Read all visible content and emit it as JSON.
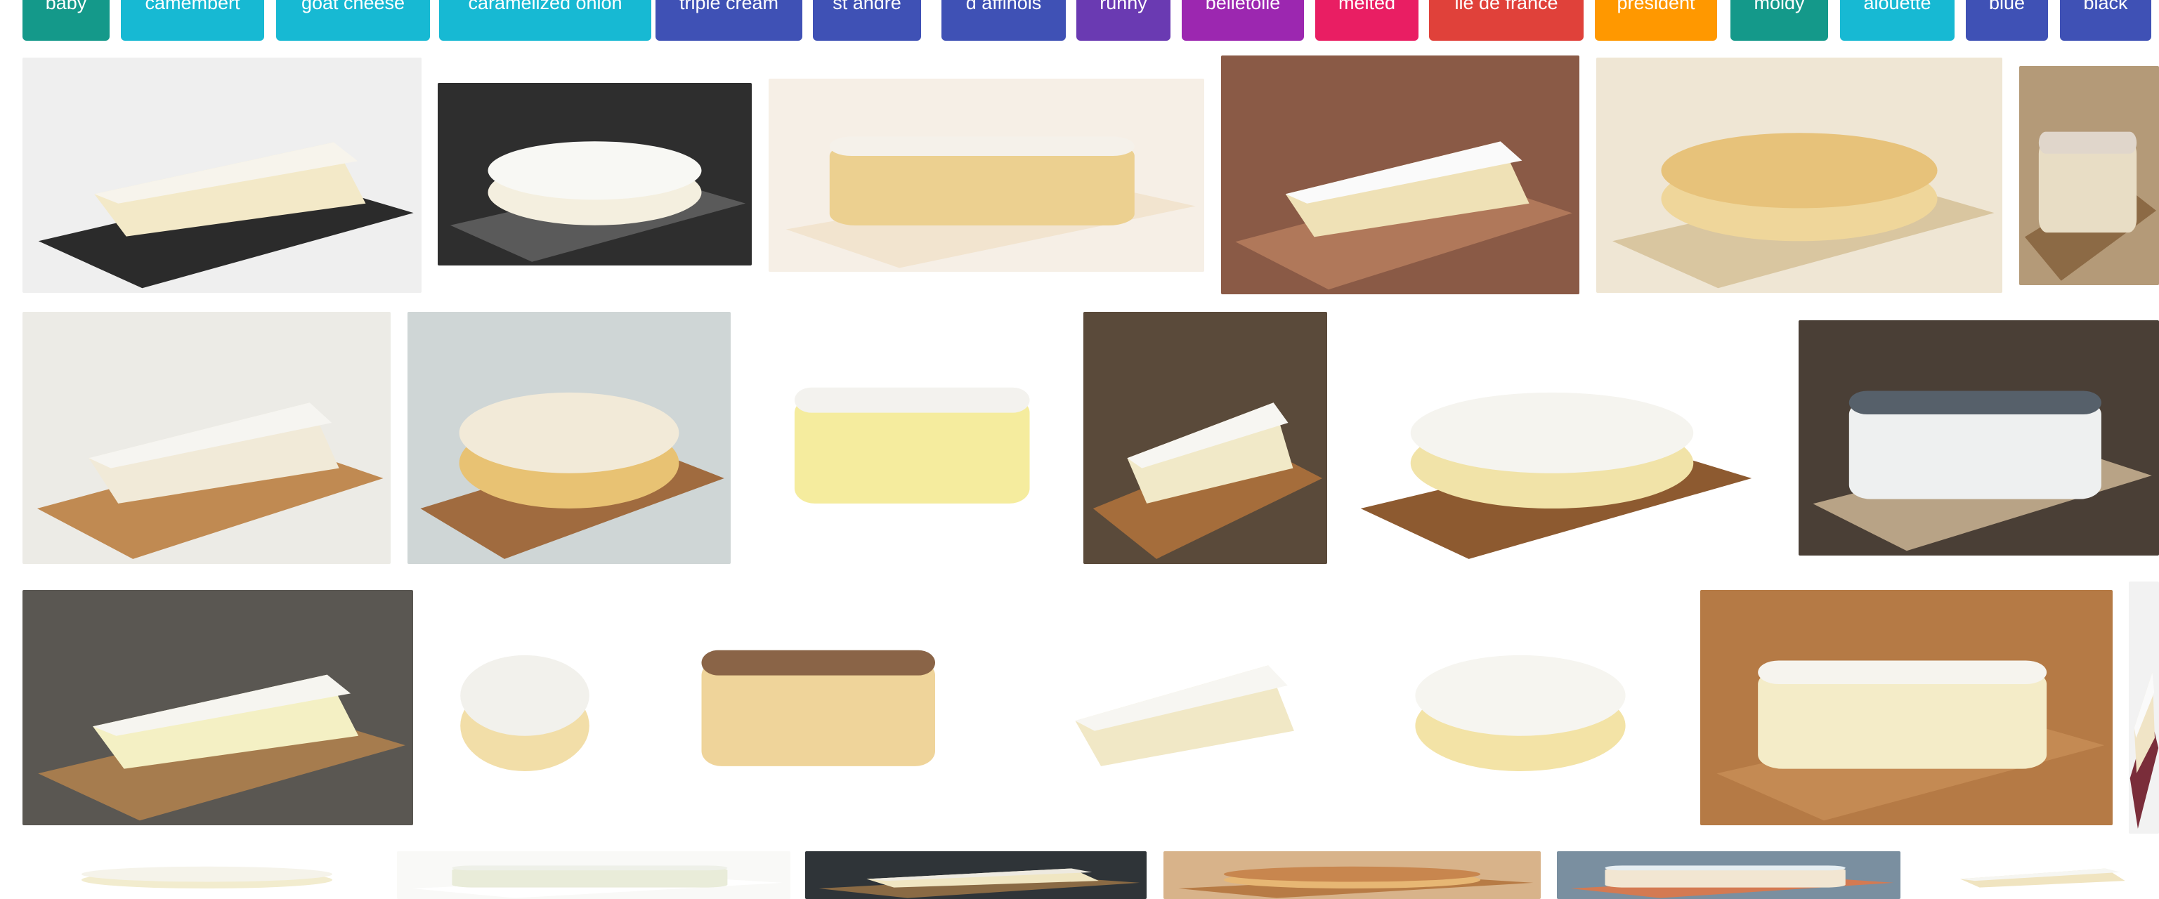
{
  "chips": [
    {
      "label": "baby",
      "color": "#14998a"
    },
    {
      "label": "camembert",
      "color": "#17b9d3"
    },
    {
      "label": "goat cheese",
      "color": "#17b9d3"
    },
    {
      "label": "caramelized onion",
      "color": "#17b9d3"
    },
    {
      "label": "triple cream",
      "color": "#3f51b5"
    },
    {
      "label": "st andre",
      "color": "#3f51b5"
    },
    {
      "label": "d affinois",
      "color": "#3f51b5"
    },
    {
      "label": "runny",
      "color": "#6a3ab2"
    },
    {
      "label": "belletoile",
      "color": "#9c27b0"
    },
    {
      "label": "melted",
      "color": "#e91e63"
    },
    {
      "label": "ile de france",
      "color": "#e0413a"
    },
    {
      "label": "president",
      "color": "#ff9800"
    },
    {
      "label": "moldy",
      "color": "#14998a"
    },
    {
      "label": "alouette",
      "color": "#17b9d3"
    },
    {
      "label": "blue",
      "color": "#3f51b5"
    },
    {
      "label": "black",
      "color": "#3f51b5"
    }
  ],
  "images": [
    {
      "name": "brie-wedge-on-slate",
      "bg": "#efefef",
      "board": "#2b2b2b",
      "cheese": "#f3e9c8",
      "rind": "#f7f4ec"
    },
    {
      "name": "brie-wheel-on-slate",
      "bg": "#2e2e2e",
      "board": "#5a5a5a",
      "cheese": "#f4efdf",
      "rind": "#f8f8f4"
    },
    {
      "name": "stacked-brie-closeup",
      "bg": "#f6efe6",
      "board": "#f2e4cf",
      "cheese": "#ecd090",
      "rind": "#f5f1ea"
    },
    {
      "name": "brie-wheel-wooden-board",
      "bg": "#8a5a46",
      "board": "#b0785a",
      "cheese": "#efe1b6",
      "rind": "#fafafa"
    },
    {
      "name": "baked-brie-caramel",
      "bg": "#efe6d4",
      "board": "#d9c6a0",
      "cheese": "#efd69a",
      "rind": "#e7c27a"
    },
    {
      "name": "brie-rustic-partial",
      "bg": "#b49a78",
      "board": "#8c6a45",
      "cheese": "#e8ddc5",
      "rind": "#e0d6cb"
    },
    {
      "name": "brie-wheel-rosemary-olives",
      "bg": "#ecebe6",
      "board": "#c08a52",
      "cheese": "#f1ead8",
      "rind": "#f6f5f1"
    },
    {
      "name": "baked-brie-crackers-apples",
      "bg": "#cfd6d6",
      "board": "#a06b3f",
      "cheese": "#e8c273",
      "rind": "#f2ead8"
    },
    {
      "name": "brie-wedge-isolated",
      "bg": "#ffffff",
      "board": "#ffffff",
      "cheese": "#f5ec9e",
      "rind": "#f3f2ee"
    },
    {
      "name": "brie-wheel-lavender-board",
      "bg": "#5a4a3a",
      "board": "#a56d3b",
      "cheese": "#f1e9c8",
      "rind": "#f7f6f2"
    },
    {
      "name": "brie-wheel-lavender-isolated",
      "bg": "#ffffff",
      "board": "#8d5a30",
      "cheese": "#f1e3a8",
      "rind": "#f5f4ef"
    },
    {
      "name": "blue-cheese-stack",
      "bg": "#4a3f36",
      "board": "#b8a386",
      "cheese": "#eef0f0",
      "rind": "#56606a"
    },
    {
      "name": "brie-wedge-cutting-board",
      "bg": "#5a5752",
      "board": "#a67c4e",
      "cheese": "#f4f0c4",
      "rind": "#f6f5f0"
    },
    {
      "name": "small-brie-wedge",
      "bg": "#ffffff",
      "board": "#ffffff",
      "cheese": "#f2dea8",
      "rind": "#f2f1ec"
    },
    {
      "name": "grilled-rind-wedge",
      "bg": "#ffffff",
      "board": "#ffffff",
      "cheese": "#efd49a",
      "rind": "#8a6447"
    },
    {
      "name": "brie-wheel-cut-slice",
      "bg": "#ffffff",
      "board": "#ffffff",
      "cheese": "#f1e8c6",
      "rind": "#f7f6f2"
    },
    {
      "name": "brie-wedge-holes",
      "bg": "#ffffff",
      "board": "#ffffff",
      "cheese": "#f3e3a6",
      "rind": "#f6f5f0"
    },
    {
      "name": "brie-slices-wood",
      "bg": "#b57a45",
      "board": "#c48a53",
      "cheese": "#f4ecc8",
      "rind": "#f6f4ee"
    },
    {
      "name": "edge-partial-image",
      "bg": "#f2f2f2",
      "board": "#7a2d3a",
      "cheese": "#f0e4c6",
      "rind": "#fafafa"
    },
    {
      "name": "row4-cheese-a",
      "bg": "#ffffff",
      "board": "#ffffff",
      "cheese": "#f2ecce",
      "rind": "#f5f3ea"
    },
    {
      "name": "row4-cheese-b",
      "bg": "#f9f9f7",
      "board": "#ffffff",
      "cheese": "#e9ecd9",
      "rind": "#eef0e8"
    },
    {
      "name": "row4-cheese-c",
      "bg": "#2f3438",
      "board": "#8a6a44",
      "cheese": "#f0e6c2",
      "rind": "#eeeae0"
    },
    {
      "name": "row4-cheese-d",
      "bg": "#d8b38a",
      "board": "#b77b45",
      "cheese": "#e7b774",
      "rind": "#c8864e"
    },
    {
      "name": "row4-cheese-e",
      "bg": "#7a8fa0",
      "board": "#d47a52",
      "cheese": "#f2e6d2",
      "rind": "#e6eef2"
    },
    {
      "name": "row4-cheese-f",
      "bg": "#ffffff",
      "board": "#ffffff",
      "cheese": "#f0e4c0",
      "rind": "#f6f6f2"
    }
  ]
}
